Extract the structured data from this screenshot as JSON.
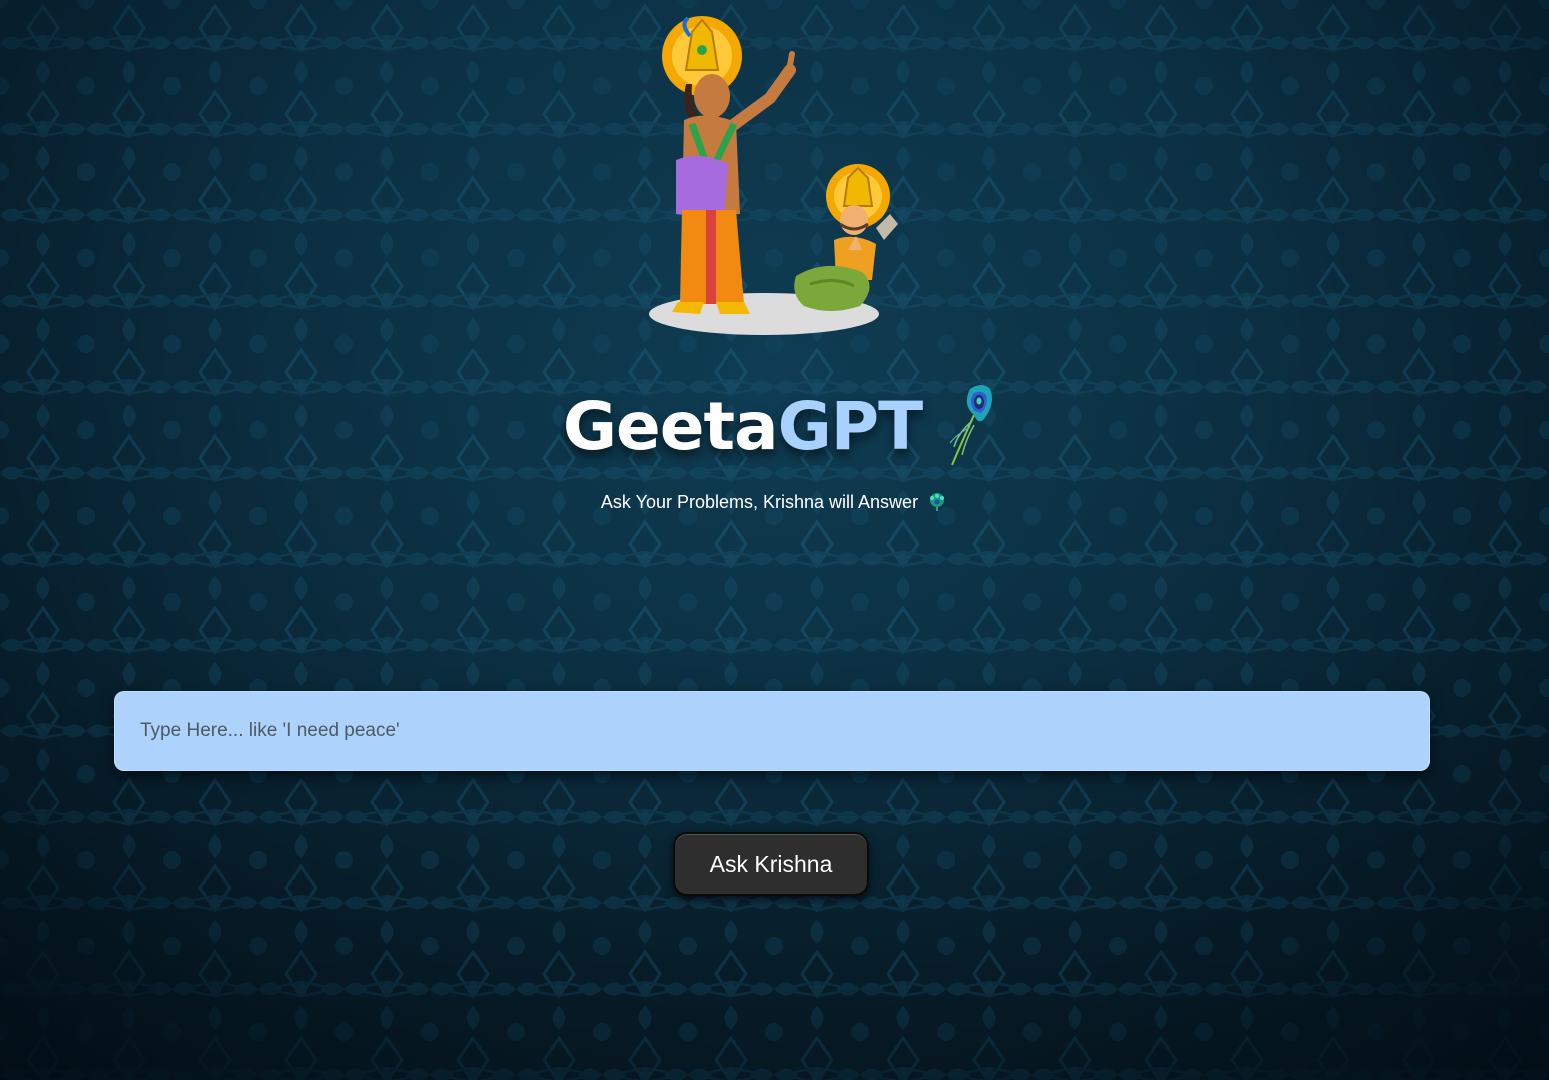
{
  "app": {
    "title_part1": "Geeta",
    "title_part2": "GPT",
    "subtitle": "Ask Your Problems, Krishna will Answer"
  },
  "hero": {
    "image": "krishna-arjuna-illustration"
  },
  "search": {
    "placeholder": "Type Here... like 'I need peace'",
    "value": ""
  },
  "actions": {
    "ask_label": "Ask Krishna"
  },
  "icons": {
    "title_icon": "peacock-feather-icon",
    "subtitle_icon": "peacock-icon"
  },
  "colors": {
    "background": "#0c3347",
    "title_accent": "#a8d1ff",
    "input_background": "#add2fb",
    "button_background": "#2e2e2e"
  }
}
